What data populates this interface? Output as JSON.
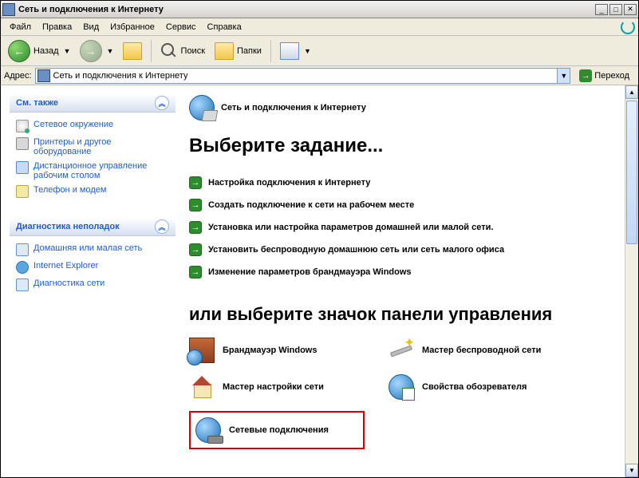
{
  "window": {
    "title": "Сеть и подключения к Интернету"
  },
  "menu": {
    "items": [
      "Файл",
      "Правка",
      "Вид",
      "Избранное",
      "Сервис",
      "Справка"
    ]
  },
  "toolbar": {
    "back_label": "Назад",
    "search_label": "Поиск",
    "folders_label": "Папки"
  },
  "addressbar": {
    "label": "Адрес:",
    "value": "Сеть и подключения к Интернету",
    "go_label": "Переход"
  },
  "sidebar": {
    "panels": [
      {
        "title": "См. также",
        "items": [
          {
            "icon": "icn-net",
            "label": "Сетевое окружение"
          },
          {
            "icon": "icn-printer",
            "label": "Принтеры и другое оборудование"
          },
          {
            "icon": "icn-remote",
            "label": "Дистанционное управление рабочим столом"
          },
          {
            "icon": "icn-phone",
            "label": "Телефон и модем"
          }
        ]
      },
      {
        "title": "Диагностика неполадок",
        "items": [
          {
            "icon": "icn-home",
            "label": "Домашняя или малая сеть"
          },
          {
            "icon": "icn-ie",
            "label": "Internet Explorer"
          },
          {
            "icon": "icn-diag",
            "label": "Диагностика сети"
          }
        ]
      }
    ]
  },
  "main": {
    "breadcrumb": "Сеть и подключения к Интернету",
    "heading1": "Выберите задание...",
    "tasks": [
      "Настройка подключения к Интернету",
      "Создать подключение к сети на рабочем месте",
      "Установка или настройка параметров домашней или малой сети.",
      "Установить беспроводную домашнюю сеть или сеть малого офиса",
      "Изменение параметров брандмауэра Windows"
    ],
    "heading2": "или выберите значок панели управления",
    "cp_items": [
      {
        "icon": "bi-wall",
        "label": "Брандмауэр Windows",
        "boxed": false
      },
      {
        "icon": "bi-wizard",
        "label": "Мастер беспроводной сети",
        "boxed": false
      },
      {
        "icon": "bi-house",
        "label": "Мастер настройки сети",
        "boxed": false
      },
      {
        "icon": "bi-globe",
        "label": "Свойства обозревателя",
        "boxed": false
      },
      {
        "icon": "bi-netconn",
        "label": "Сетевые подключения",
        "boxed": true
      }
    ]
  }
}
